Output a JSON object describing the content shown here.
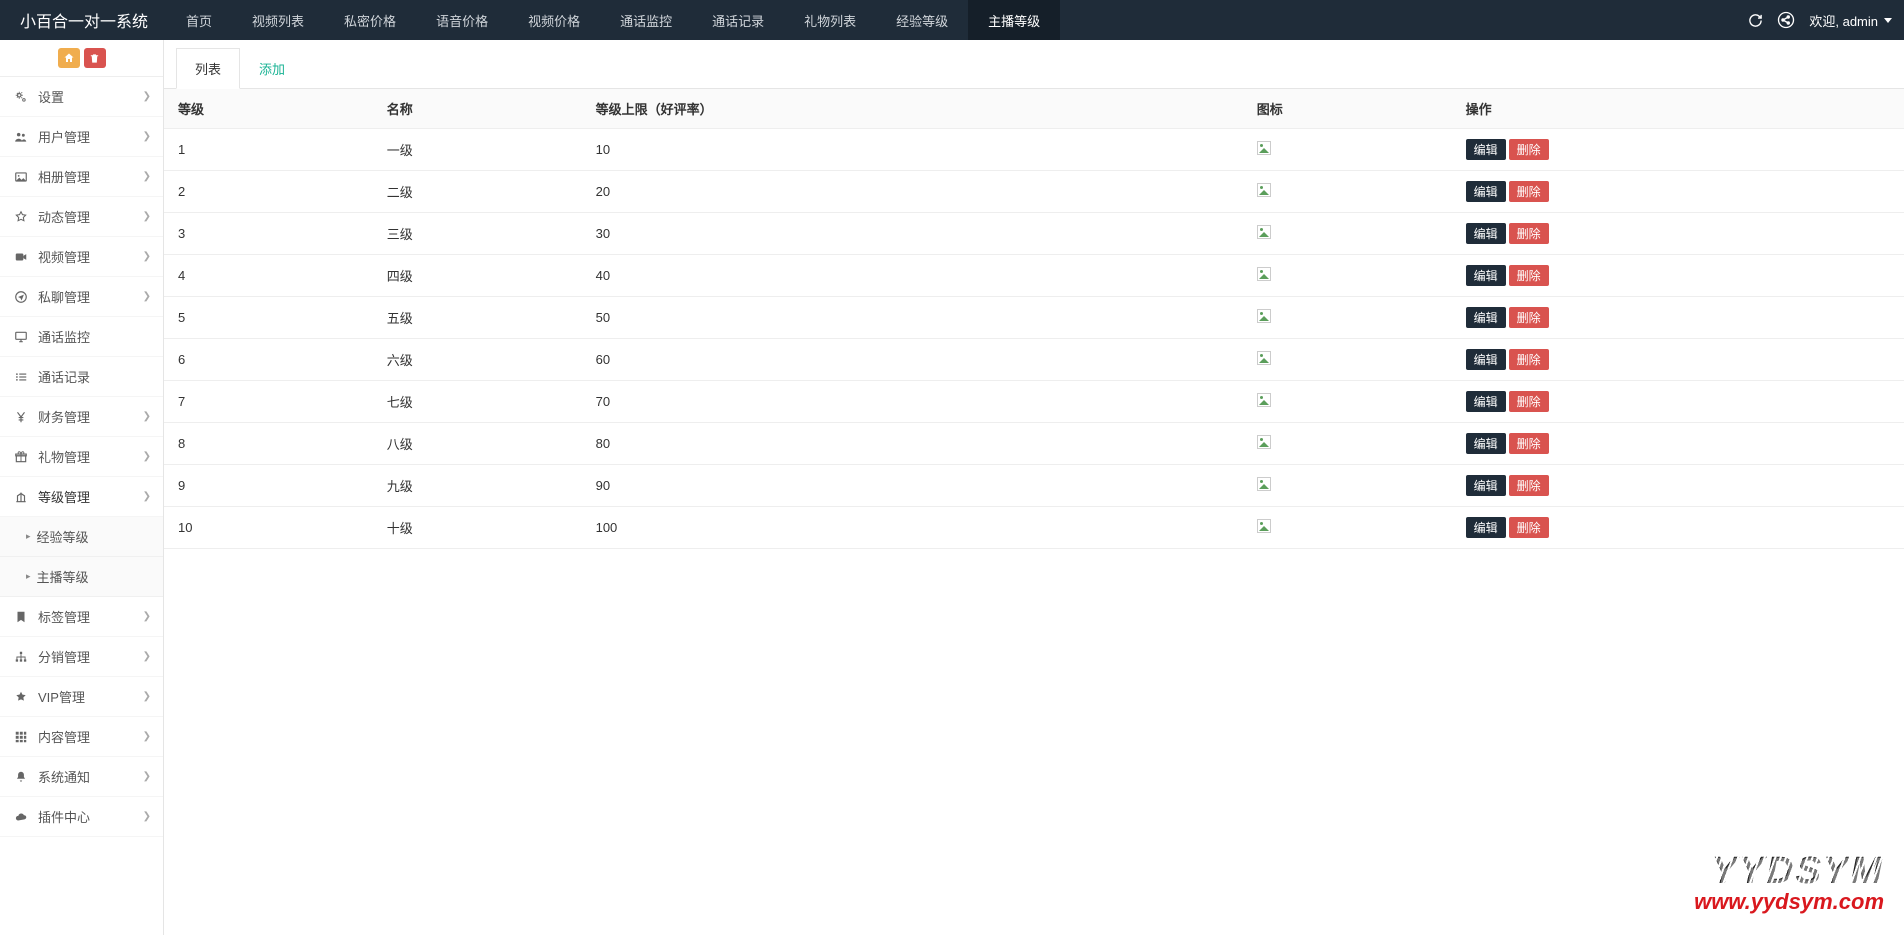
{
  "brand": "小百合一对一系统",
  "topnav": [
    {
      "label": "首页",
      "active": false
    },
    {
      "label": "视频列表",
      "active": false
    },
    {
      "label": "私密价格",
      "active": false
    },
    {
      "label": "语音价格",
      "active": false
    },
    {
      "label": "视频价格",
      "active": false
    },
    {
      "label": "通话监控",
      "active": false
    },
    {
      "label": "通话记录",
      "active": false
    },
    {
      "label": "礼物列表",
      "active": false
    },
    {
      "label": "经验等级",
      "active": false
    },
    {
      "label": "主播等级",
      "active": true
    }
  ],
  "user": {
    "greet": "欢迎, admin"
  },
  "sidebar": [
    {
      "icon": "cogs",
      "label": "设置",
      "expand": true
    },
    {
      "icon": "users",
      "label": "用户管理",
      "expand": true
    },
    {
      "icon": "image",
      "label": "相册管理",
      "expand": true
    },
    {
      "icon": "star-o",
      "label": "动态管理",
      "expand": true
    },
    {
      "icon": "video",
      "label": "视频管理",
      "expand": true
    },
    {
      "icon": "send",
      "label": "私聊管理",
      "expand": true
    },
    {
      "icon": "desktop",
      "label": "通话监控",
      "expand": false
    },
    {
      "icon": "list",
      "label": "通话记录",
      "expand": false
    },
    {
      "icon": "yen",
      "label": "财务管理",
      "expand": true
    },
    {
      "icon": "gift",
      "label": "礼物管理",
      "expand": true
    },
    {
      "icon": "level",
      "label": "等级管理",
      "expand": true,
      "active": true,
      "subs": [
        {
          "label": "经验等级"
        },
        {
          "label": "主播等级"
        }
      ]
    },
    {
      "icon": "bookmark",
      "label": "标签管理",
      "expand": true
    },
    {
      "icon": "sitemap",
      "label": "分销管理",
      "expand": true
    },
    {
      "icon": "star",
      "label": "VIP管理",
      "expand": true
    },
    {
      "icon": "grid",
      "label": "内容管理",
      "expand": true
    },
    {
      "icon": "bell",
      "label": "系统通知",
      "expand": true
    },
    {
      "icon": "cloud",
      "label": "插件中心",
      "expand": true
    }
  ],
  "tabs": {
    "list": "列表",
    "add": "添加"
  },
  "table": {
    "headers": {
      "level": "等级",
      "name": "名称",
      "upper": "等级上限（好评率）",
      "icon": "图标",
      "ops": "操作"
    },
    "rows": [
      {
        "level": "1",
        "name": "一级",
        "upper": "10"
      },
      {
        "level": "2",
        "name": "二级",
        "upper": "20"
      },
      {
        "level": "3",
        "name": "三级",
        "upper": "30"
      },
      {
        "level": "4",
        "name": "四级",
        "upper": "40"
      },
      {
        "level": "5",
        "name": "五级",
        "upper": "50"
      },
      {
        "level": "6",
        "name": "六级",
        "upper": "60"
      },
      {
        "level": "7",
        "name": "七级",
        "upper": "70"
      },
      {
        "level": "8",
        "name": "八级",
        "upper": "80"
      },
      {
        "level": "9",
        "name": "九级",
        "upper": "90"
      },
      {
        "level": "10",
        "name": "十级",
        "upper": "100"
      }
    ],
    "editLabel": "编辑",
    "delLabel": "删除"
  },
  "watermark": {
    "line1": "YYDSYM",
    "line2": "www.yydsym.com"
  }
}
